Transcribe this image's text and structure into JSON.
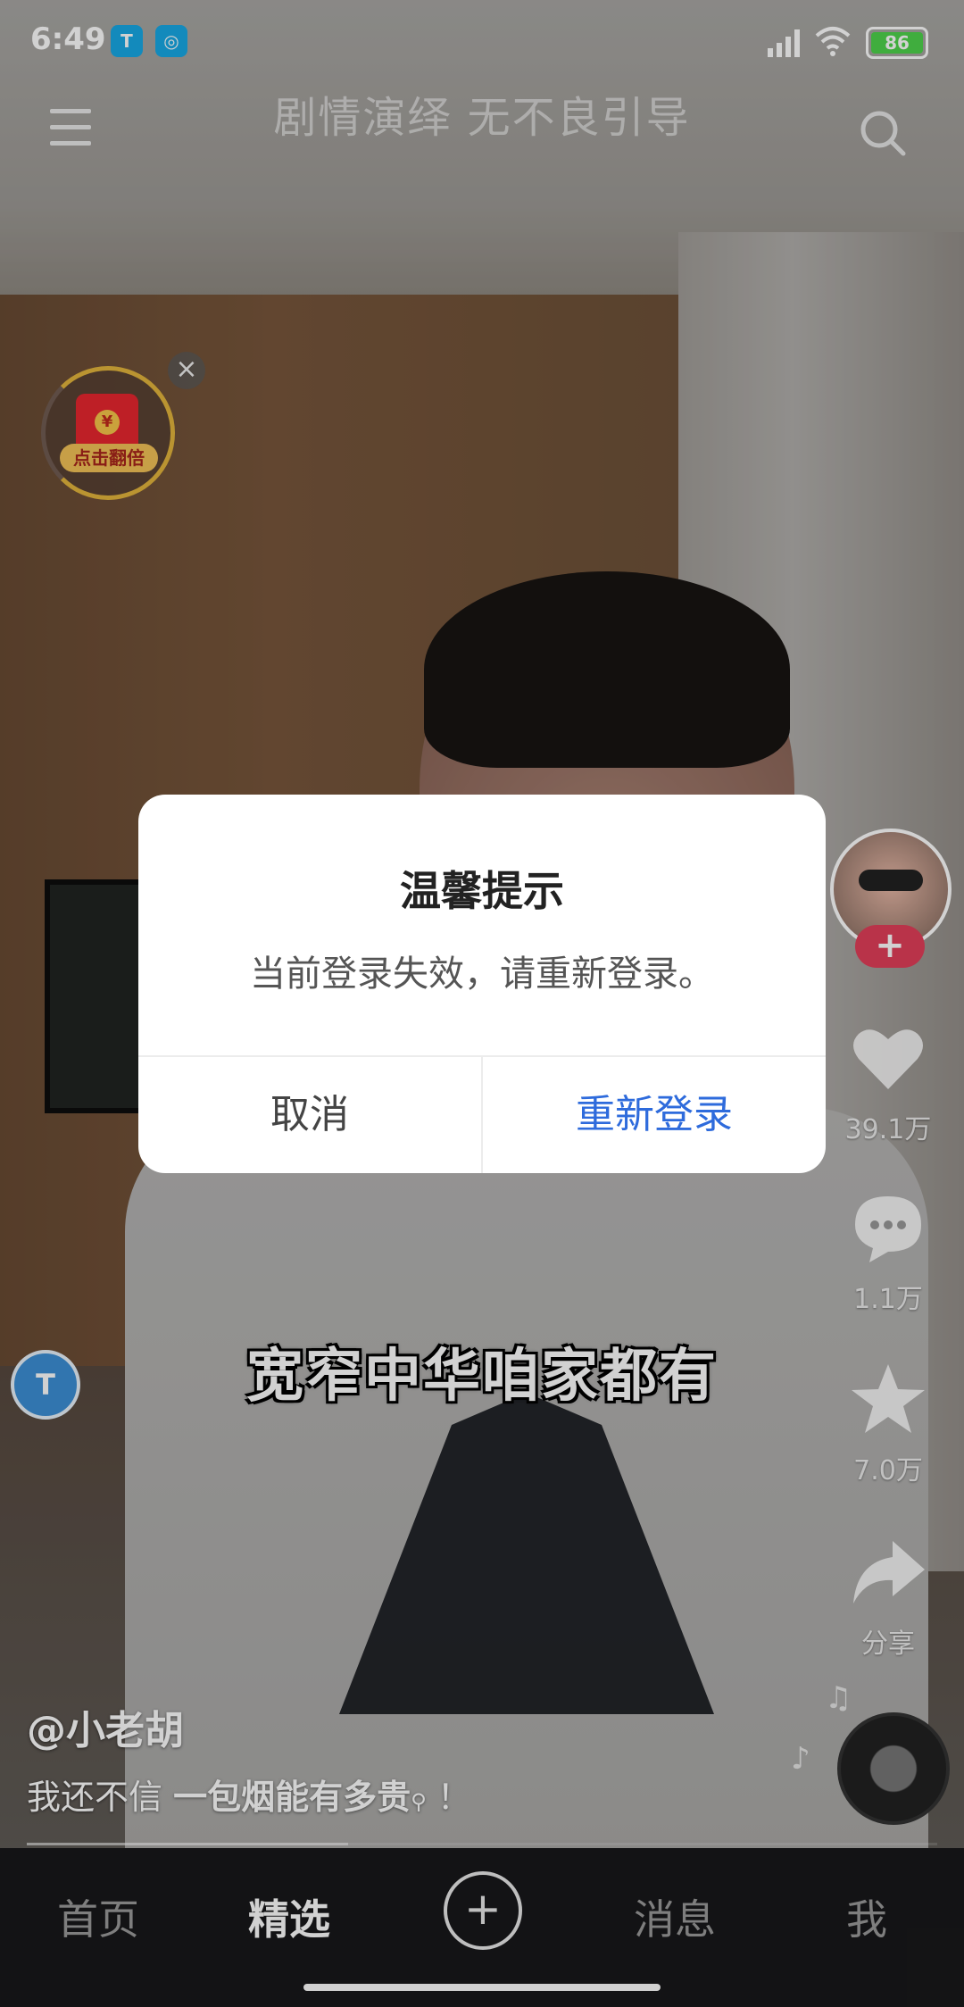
{
  "status_bar": {
    "time": "6:49",
    "battery": "86"
  },
  "top_bar": {
    "title": "剧情演绎 无不良引导"
  },
  "red_packet": {
    "label": "点击翻倍"
  },
  "rail": {
    "likes": "39.1万",
    "comments": "1.1万",
    "favorites": "7.0万",
    "share": "分享"
  },
  "video": {
    "subtitle": "宽窄中华咱家都有",
    "author": "@小老胡",
    "desc_prefix": "我还不信",
    "desc_bold": "一包烟能有多贵",
    "desc_suffix": " ！"
  },
  "dialog": {
    "title": "温馨提示",
    "message": "当前登录失效，请重新登录。",
    "cancel": "取消",
    "confirm": "重新登录"
  },
  "bottom_nav": {
    "items": [
      "首页",
      "精选",
      "消息",
      "我"
    ],
    "active": "精选"
  }
}
